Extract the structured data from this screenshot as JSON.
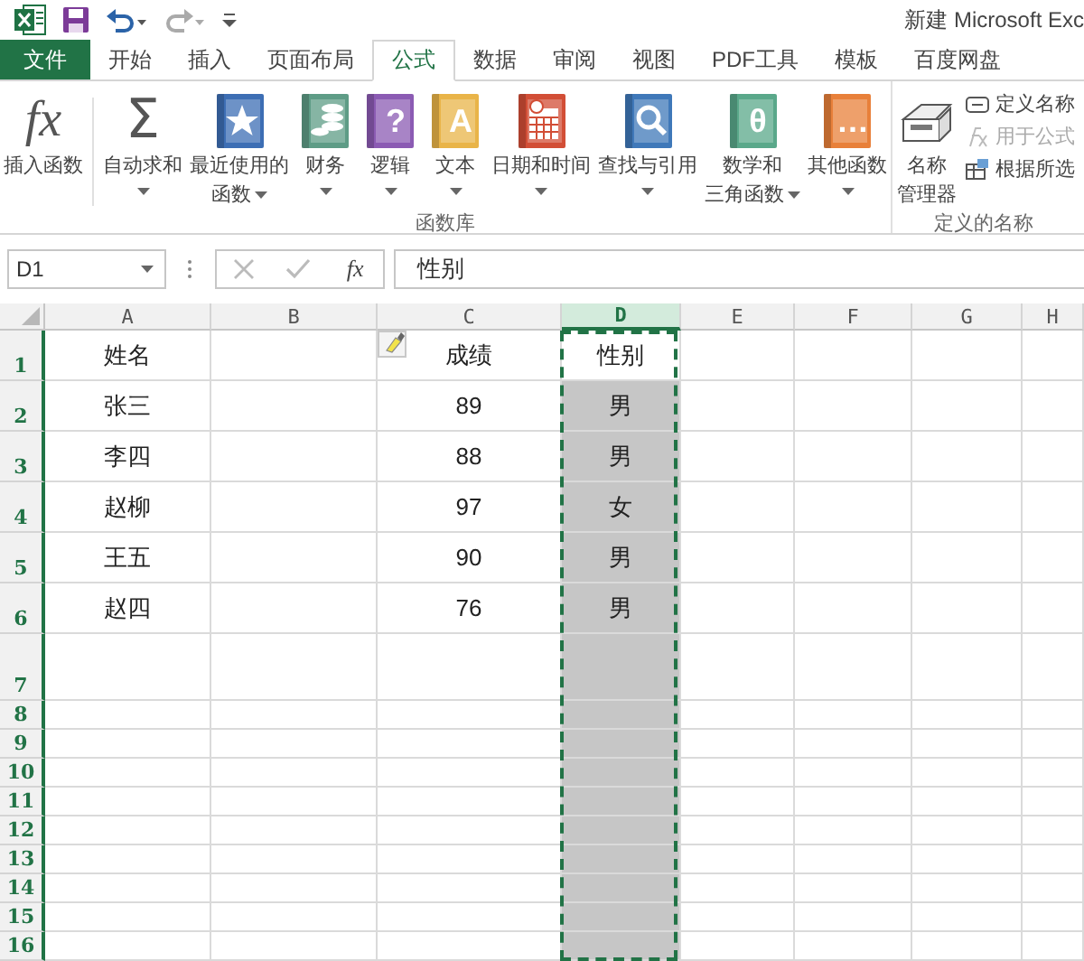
{
  "window": {
    "title": "新建 Microsoft Exc"
  },
  "tabs": [
    {
      "label": "文件",
      "kind": "file",
      "selected": false
    },
    {
      "label": "开始",
      "kind": "tab",
      "selected": false
    },
    {
      "label": "插入",
      "kind": "tab",
      "selected": false
    },
    {
      "label": "页面布局",
      "kind": "tab",
      "selected": false
    },
    {
      "label": "公式",
      "kind": "tab",
      "selected": true
    },
    {
      "label": "数据",
      "kind": "tab",
      "selected": false
    },
    {
      "label": "审阅",
      "kind": "tab",
      "selected": false
    },
    {
      "label": "视图",
      "kind": "tab",
      "selected": false
    },
    {
      "label": "PDF工具",
      "kind": "tab",
      "selected": false
    },
    {
      "label": "模板",
      "kind": "tab",
      "selected": false
    },
    {
      "label": "百度网盘",
      "kind": "tab",
      "selected": false
    }
  ],
  "ribbon": {
    "groups": [
      {
        "label": "函数库",
        "commands": [
          {
            "kind": "fx",
            "glyph": "fx",
            "lines": [
              "插入函数"
            ],
            "dropdown": false
          },
          {
            "kind": "sum",
            "glyph": "Σ",
            "lines": [
              "自动求和"
            ],
            "dropdown": true
          },
          {
            "kind": "star-book",
            "color": "#3d6eb4",
            "lines": [
              "最近使用的",
              "函数"
            ],
            "dropdown": true
          },
          {
            "kind": "coins-book",
            "color": "#5e9c86",
            "lines": [
              "财务"
            ],
            "dropdown": true
          },
          {
            "kind": "glyph-book",
            "glyph": "?",
            "color": "#8b5bb3",
            "lines": [
              "逻辑"
            ],
            "dropdown": true
          },
          {
            "kind": "glyph-book",
            "glyph": "A",
            "color": "#e9b448",
            "lines": [
              "文本"
            ],
            "dropdown": true
          },
          {
            "kind": "calendar-book",
            "color": "#d24e36",
            "lines": [
              "日期和时间"
            ],
            "dropdown": true
          },
          {
            "kind": "magnifier-book",
            "color": "#3f78b9",
            "lines": [
              "查找与引用"
            ],
            "dropdown": true
          },
          {
            "kind": "glyph-book",
            "glyph": "θ",
            "color": "#5aa88a",
            "lines": [
              "数学和",
              "三角函数"
            ],
            "dropdown": true
          },
          {
            "kind": "glyph-book",
            "glyph": "…",
            "color": "#e8803a",
            "lines": [
              "其他函数"
            ],
            "dropdown": true
          }
        ]
      },
      {
        "label": "定义的名称",
        "commands": [
          {
            "kind": "manager",
            "lines": [
              "名称",
              "管理器"
            ],
            "dropdown": false
          }
        ],
        "small_commands": [
          {
            "label": "定义名称",
            "kind": "tag",
            "disabled": false
          },
          {
            "label": "用于公式",
            "kind": "fx",
            "disabled": true
          },
          {
            "label": "根据所选",
            "kind": "sheet",
            "disabled": false
          }
        ]
      }
    ]
  },
  "formula_bar": {
    "name_box": "D1",
    "buttons": [
      {
        "kind": "cancel",
        "disabled": true
      },
      {
        "kind": "enter",
        "disabled": true
      },
      {
        "kind": "function",
        "glyph": "fx",
        "disabled": false
      }
    ],
    "formula": "性别"
  },
  "columns": [
    {
      "label": "A",
      "selected": false,
      "marquee": false
    },
    {
      "label": "B",
      "selected": false,
      "marquee": false
    },
    {
      "label": "C",
      "selected": false,
      "marquee": false
    },
    {
      "label": "D",
      "selected": true,
      "marquee": true
    },
    {
      "label": "E",
      "selected": false,
      "marquee": false
    },
    {
      "label": "F",
      "selected": false,
      "marquee": false
    },
    {
      "label": "G",
      "selected": false,
      "marquee": false
    },
    {
      "label": "H",
      "selected": false,
      "marquee": false
    }
  ],
  "rows": [
    {
      "number": "1",
      "active": true,
      "cells": {
        "A": "姓名",
        "C": "成绩",
        "D": "性别"
      }
    },
    {
      "number": "2",
      "active": false,
      "cells": {
        "A": "张三",
        "C": "89",
        "D": "男"
      }
    },
    {
      "number": "3",
      "active": false,
      "cells": {
        "A": "李四",
        "C": "88",
        "D": "男"
      }
    },
    {
      "number": "4",
      "active": false,
      "cells": {
        "A": "赵柳",
        "C": "97",
        "D": "女"
      }
    },
    {
      "number": "5",
      "active": false,
      "cells": {
        "A": "王五",
        "C": "90",
        "D": "男"
      }
    },
    {
      "number": "6",
      "active": false,
      "cells": {
        "A": "赵四",
        "C": "76",
        "D": "男"
      }
    },
    {
      "number": "7",
      "active": false
    },
    {
      "number": "8",
      "active": false
    },
    {
      "number": "9",
      "active": false
    },
    {
      "number": "10",
      "active": false
    },
    {
      "number": "11",
      "active": false
    },
    {
      "number": "12",
      "active": false
    },
    {
      "number": "13",
      "active": false
    },
    {
      "number": "14",
      "active": false
    },
    {
      "number": "15",
      "active": false
    },
    {
      "number": "16",
      "active": false
    }
  ]
}
